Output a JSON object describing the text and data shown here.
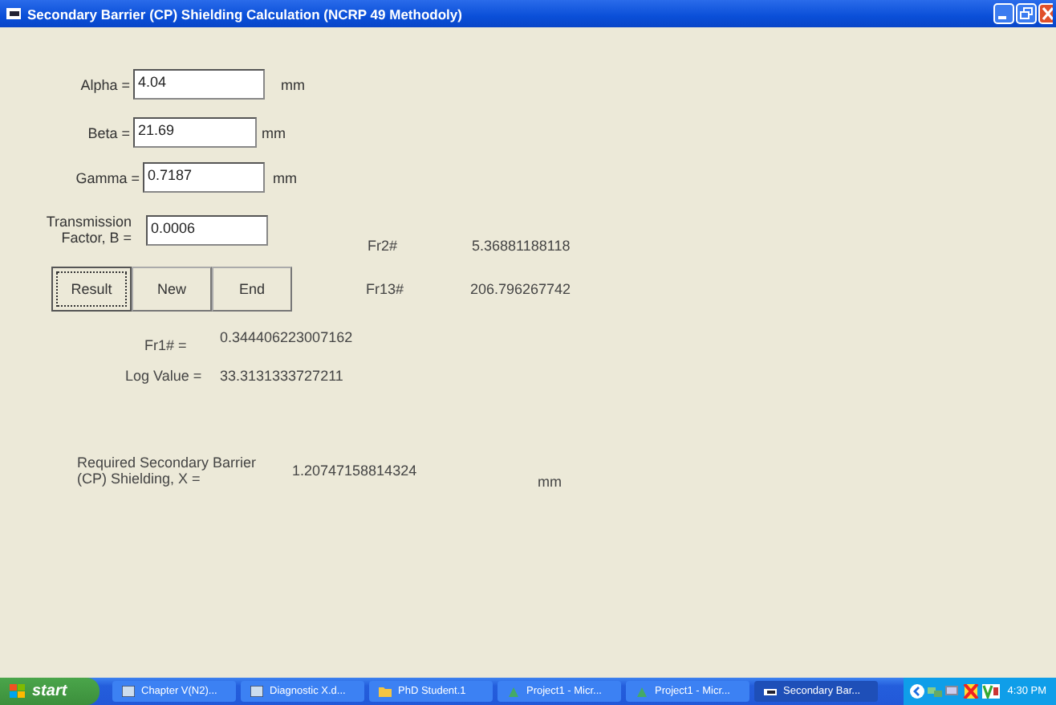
{
  "window": {
    "title": "Secondary Barrier (CP) Shielding Calculation (NCRP  49  Methodoly)"
  },
  "fields": [
    {
      "label": "Alpha =",
      "value": "4.04",
      "unit": "mm"
    },
    {
      "label": "Beta =",
      "value": "21.69",
      "unit": "mm"
    },
    {
      "label": "Gamma =",
      "value": "0.7187",
      "unit": "mm"
    },
    {
      "label": "Transmission Factor, B =",
      "value": "0.0006"
    }
  ],
  "buttons": [
    {
      "label": "Result",
      "focused": true
    },
    {
      "label": "New",
      "focused": false
    },
    {
      "label": "End",
      "focused": false
    }
  ],
  "side_results": [
    {
      "label": "Fr2#",
      "value": "5.36881188118"
    },
    {
      "label": "Fr13#",
      "value": "206.796267742"
    }
  ],
  "results": [
    {
      "label": "Fr1# =",
      "value": "0.344406223007162"
    },
    {
      "label": "Log Value =",
      "value": "33.3131333727211"
    }
  ],
  "required": {
    "label": "Required Secondary Barrier (CP) Shielding, X  =",
    "value": "1.20747158814324",
    "unit": "mm"
  },
  "taskbar": {
    "start": "start",
    "items": [
      {
        "label": "Chapter V(N2)...",
        "selected": false
      },
      {
        "label": "Diagnostic X.d...",
        "selected": false
      },
      {
        "label": "PhD Student.1",
        "selected": false
      },
      {
        "label": "Project1 - Micr...",
        "selected": false
      },
      {
        "label": "Project1 - Micr...",
        "selected": false
      },
      {
        "label": "Secondary Bar...",
        "selected": true
      }
    ],
    "clock": "4:30 PM"
  }
}
